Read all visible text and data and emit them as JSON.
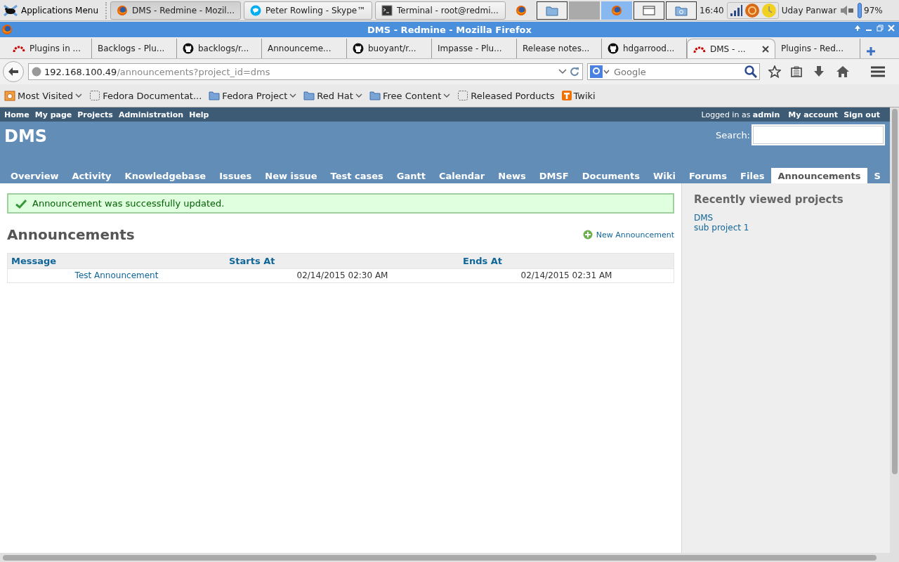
{
  "taskbar": {
    "apps_menu": "Applications Menu",
    "tasks": [
      {
        "label": "DMS - Redmine - Mozil...",
        "kind": "firefox",
        "selected": true
      },
      {
        "label": "Peter Rowling - Skype™",
        "kind": "skype",
        "selected": false
      },
      {
        "label": "Terminal - root@redmi...",
        "kind": "terminal",
        "selected": false
      }
    ],
    "workspaces": [
      {
        "kind": "folder",
        "selected": false
      },
      {
        "kind": "empty",
        "selected": false
      },
      {
        "kind": "firefox",
        "selected": true
      },
      {
        "kind": "window",
        "selected": false
      },
      {
        "kind": "camera",
        "selected": false
      }
    ],
    "clock": "16:40",
    "user": "Uday Panwar",
    "battery": "97%"
  },
  "window": {
    "title": "DMS - Redmine - Mozilla Firefox"
  },
  "browser_tabs": [
    {
      "label": "Plugins in ...",
      "kind": "redmine",
      "selected": false
    },
    {
      "label": "Backlogs - Plu...",
      "kind": "plain",
      "selected": false
    },
    {
      "label": "backlogs/r...",
      "kind": "github",
      "selected": false
    },
    {
      "label": "Announceme...",
      "kind": "plain",
      "selected": false
    },
    {
      "label": "buoyant/r...",
      "kind": "github",
      "selected": false
    },
    {
      "label": "Impasse - Plu...",
      "kind": "plain",
      "selected": false
    },
    {
      "label": "Release notes...",
      "kind": "plain",
      "selected": false
    },
    {
      "label": "hdgarrood...",
      "kind": "github",
      "selected": false
    },
    {
      "label": "DMS - ...",
      "kind": "redmine",
      "selected": true
    },
    {
      "label": "Plugins - Red...",
      "kind": "plain",
      "selected": false
    }
  ],
  "address_bar": {
    "host": "192.168.100.49",
    "path": "/announcements?project_id=dms"
  },
  "search_bar": {
    "placeholder": "Google"
  },
  "bookmarks": [
    {
      "label": "Most Visited",
      "kind": "history",
      "menu": true
    },
    {
      "label": "Fedora Documentat...",
      "kind": "page",
      "menu": false
    },
    {
      "label": "Fedora Project",
      "kind": "folder",
      "menu": true
    },
    {
      "label": "Red Hat",
      "kind": "folder",
      "menu": true
    },
    {
      "label": "Free Content",
      "kind": "folder",
      "menu": true
    },
    {
      "label": "Released Porducts",
      "kind": "page",
      "menu": false
    },
    {
      "label": "Twiki",
      "kind": "twiki",
      "menu": false
    }
  ],
  "redmine": {
    "top_menu": [
      "Home",
      "My page",
      "Projects",
      "Administration",
      "Help"
    ],
    "logged_in": "Logged in as **admin**",
    "account_menu": [
      "My account",
      "Sign out"
    ],
    "project_title": "DMS",
    "search_label": "Search:",
    "tabs": [
      {
        "label": "Overview",
        "selected": false
      },
      {
        "label": "Activity",
        "selected": false
      },
      {
        "label": "Knowledgebase",
        "selected": false
      },
      {
        "label": "Issues",
        "selected": false
      },
      {
        "label": "New issue",
        "selected": false
      },
      {
        "label": "Test cases",
        "selected": false
      },
      {
        "label": "Gantt",
        "selected": false
      },
      {
        "label": "Calendar",
        "selected": false
      },
      {
        "label": "News",
        "selected": false
      },
      {
        "label": "DMSF",
        "selected": false
      },
      {
        "label": "Documents",
        "selected": false
      },
      {
        "label": "Wiki",
        "selected": false
      },
      {
        "label": "Forums",
        "selected": false
      },
      {
        "label": "Files",
        "selected": false
      },
      {
        "label": "Announcements",
        "selected": true
      },
      {
        "label": "S",
        "selected": false
      }
    ],
    "flash": "Announcement was successfully updated.",
    "heading": "Announcements",
    "new_link": "New Announcement",
    "table": {
      "columns": [
        "Message",
        "Starts At",
        "Ends At"
      ],
      "rows": [
        [
          "Test Announcement",
          "02/14/2015 02:30 AM",
          "02/14/2015 02:31 AM"
        ]
      ]
    },
    "sidebar": {
      "title": "Recently viewed projects",
      "links": [
        "DMS",
        "sub project 1"
      ]
    }
  }
}
